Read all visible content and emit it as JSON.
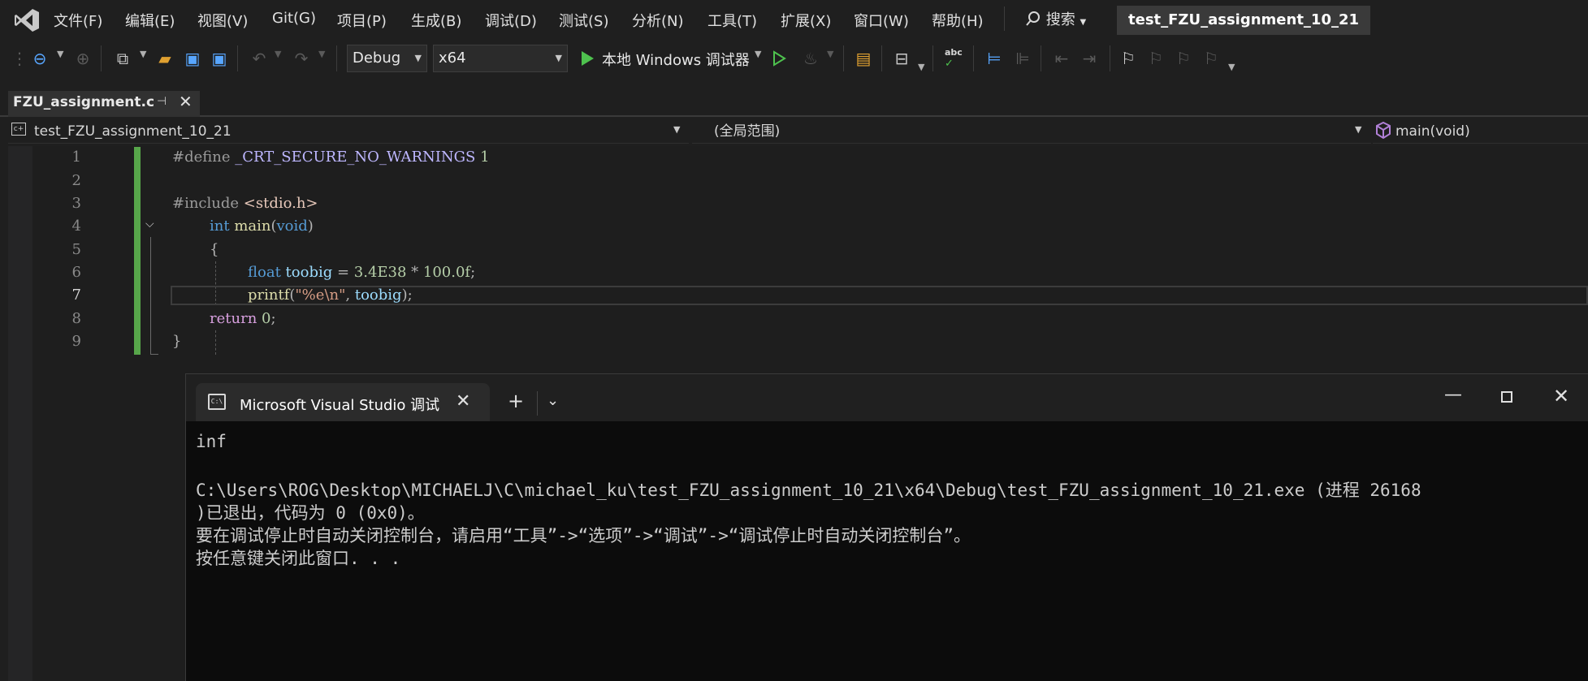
{
  "menubar": {
    "items": [
      "文件(F)",
      "编辑(E)",
      "视图(V)",
      "Git(G)",
      "项目(P)",
      "生成(B)",
      "调试(D)",
      "测试(S)",
      "分析(N)",
      "工具(T)",
      "扩展(X)",
      "窗口(W)",
      "帮助(H)"
    ],
    "search_label": "搜索",
    "solution_title": "test_FZU_assignment_10_21"
  },
  "toolbar": {
    "configuration": "Debug",
    "platform": "x64",
    "run_label": "本地 Windows 调试器"
  },
  "document_tab": {
    "title": "FZU_assignment.c"
  },
  "navbar": {
    "project": "test_FZU_assignment_10_21",
    "scope": "(全局范围)",
    "member": "main(void)"
  },
  "editor": {
    "current_line": 7,
    "line_numbers": [
      "1",
      "2",
      "3",
      "4",
      "5",
      "6",
      "7",
      "8",
      "9"
    ],
    "code": {
      "l1_pre": "#define ",
      "l1_macro": "_CRT_SECURE_NO_WARNINGS",
      "l1_num": " 1",
      "l3_pre": "#include ",
      "l3_inc": "<stdio.h>",
      "l4_kw": "int ",
      "l4_fn": "main",
      "l4_p1": "(",
      "l4_kw2": "void",
      "l4_p2": ")",
      "l5_brace": "{",
      "l6_kw": "float ",
      "l6_var": "toobig",
      "l6_op": " = ",
      "l6_num1": "3.4E38",
      "l6_op2": " * ",
      "l6_num2": "100.0f",
      "l6_semi": ";",
      "l7_fn": "printf",
      "l7_p1": "(",
      "l7_str": "\"%e\\n\"",
      "l7_comma": ", ",
      "l7_var": "toobig",
      "l7_p2": ");",
      "l8_ctrl": "return ",
      "l8_num": "0",
      "l8_semi": ";",
      "l9_brace": "}"
    }
  },
  "console": {
    "tab_title": "Microsoft Visual Studio 调试控制台",
    "lines": [
      "inf",
      "",
      "C:\\Users\\ROG\\Desktop\\MICHAELJ\\C\\michael_ku\\test_FZU_assignment_10_21\\x64\\Debug\\test_FZU_assignment_10_21.exe (进程 26168",
      ")已退出，代码为 0 (0x0)。",
      "要在调试停止时自动关闭控制台，请启用“工具”->“选项”->“调试”->“调试停止时自动关闭控制台”。",
      "按任意键关闭此窗口. . ."
    ]
  }
}
